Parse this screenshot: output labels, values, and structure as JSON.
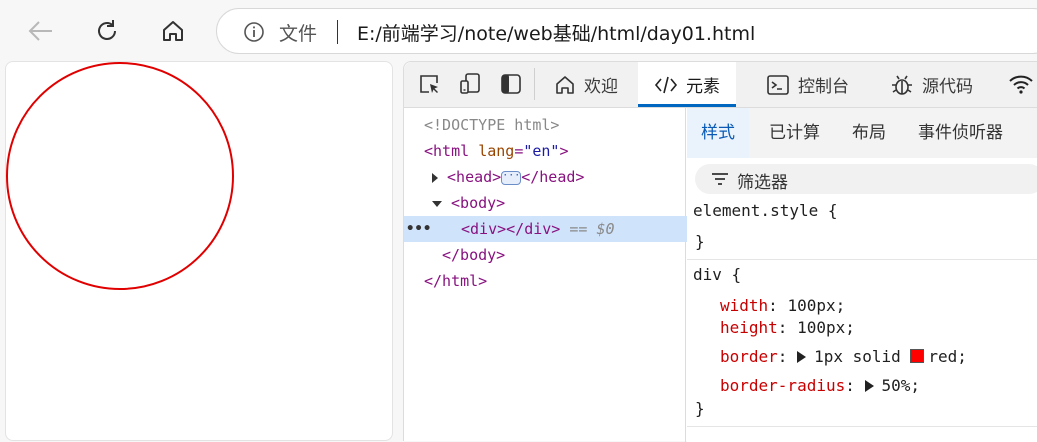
{
  "browser": {
    "address_label": "文件",
    "url": "E:/前端学习/note/web基础/html/day01.html"
  },
  "devtools": {
    "tabs": [
      {
        "label": "欢迎",
        "icon": "home-icon"
      },
      {
        "label": "元素",
        "icon": "code-icon"
      },
      {
        "label": "控制台",
        "icon": "console-icon"
      },
      {
        "label": "源代码",
        "icon": "bug-icon"
      }
    ],
    "active_tab": "元素",
    "tree": {
      "doctype": "<!DOCTYPE html>",
      "html_open": "<html",
      "lang_attr": "lang",
      "lang_val": "\"en\"",
      "head_open": "<head>",
      "head_close": "</head>",
      "body_open": "<body>",
      "div_tag": "<div></div>",
      "div_ref": "== $0",
      "body_close": "</body>",
      "html_close": "</html>",
      "gt": ">"
    },
    "styles": {
      "subtabs": [
        "样式",
        "已计算",
        "布局",
        "事件侦听器"
      ],
      "filter_placeholder": "筛选器",
      "element_style": "element.style {",
      "close_brace": "}",
      "div_selector": "div {",
      "props": [
        {
          "name": "width",
          "value": "100px;"
        },
        {
          "name": "height",
          "value": "100px;"
        },
        {
          "name": "border",
          "value": "1px solid",
          "color_name": "red;",
          "color": "#ff0000"
        },
        {
          "name": "border-radius",
          "value": "50%;"
        }
      ]
    }
  },
  "page": {
    "circle_border_color": "#e00000"
  }
}
